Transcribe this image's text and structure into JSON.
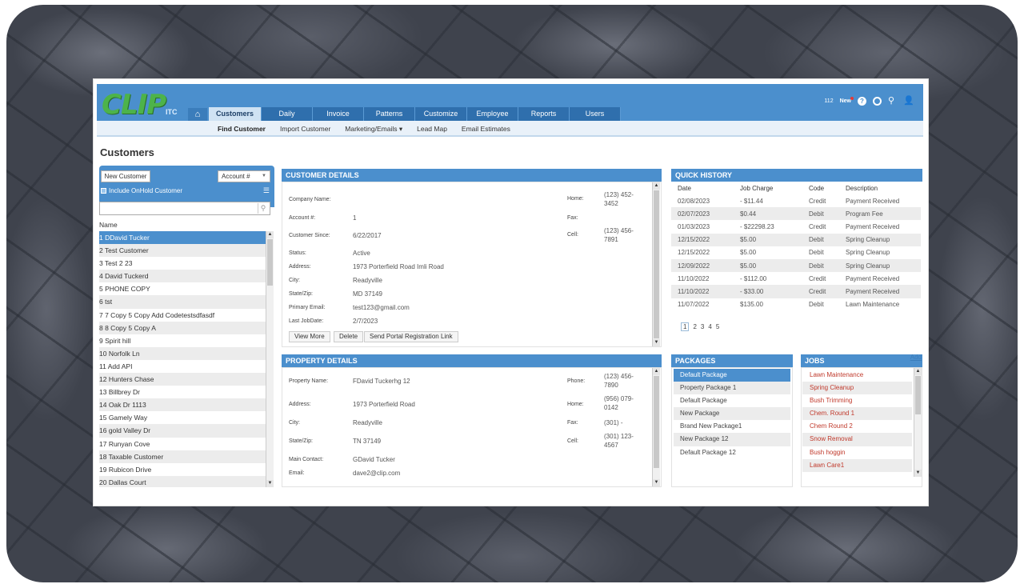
{
  "header": {
    "logo_text": "CLIP",
    "logo_sub": "ITC",
    "count": "112",
    "news_label": "New",
    "nav": [
      "Customers",
      "Daily",
      "Invoice",
      "Patterns",
      "Customize",
      "Employee",
      "Reports",
      "Users"
    ]
  },
  "subnav": [
    "Find Customer",
    "Import Customer",
    "Marketing/Emails ▾",
    "Lead Map",
    "Email Estimates"
  ],
  "page_title": "Customers",
  "left": {
    "new_customer": "New Customer",
    "account_select": "Account #",
    "onhold_label": "Include OnHold Customer",
    "search_value": "",
    "column_header": "Name",
    "customers": [
      "1 DDavid Tucker",
      "2 Test Customer",
      "3 Test 2 23",
      "4 David Tuckerd",
      "5 PHONE COPY",
      "6 tst",
      "7 7 Copy 5 Copy Add Codetestsdfasdf",
      "8 8 Copy 5 Copy A",
      "9 Spirit hill",
      "10 Norfolk Ln",
      "11 Add API",
      "12 Hunters Chase",
      "13 Billbrey Dr",
      "14 Oak Dr 1113",
      "15 Gamely Way",
      "16 gold Valley Dr",
      "17 Runyan Cove",
      "18 Taxable Customer",
      "19 Rubicon Drive",
      "20 Dallas Court"
    ]
  },
  "customer_details": {
    "title": "CUSTOMER DETAILS",
    "company_label": "Company Name:",
    "company": "",
    "account_label": "Account #:",
    "account": "1",
    "since_label": "Customer Since:",
    "since": "6/22/2017",
    "status_label": "Status:",
    "status": "Active",
    "address_label": "Address:",
    "address": "1973 Porterfield Road Imli Road",
    "city_label": "City:",
    "city": "Readyville",
    "statezip_label": "State/Zip:",
    "statezip": "MD 37149",
    "email_label": "Primary Email:",
    "email": "test123@gmail.com",
    "lastjob_label": "Last JobDate:",
    "lastjob": "2/7/2023",
    "home_label": "Home:",
    "home": "(123) 452-3452",
    "fax_label": "Fax:",
    "fax": "",
    "cell_label": "Cell:",
    "cell": "(123) 456-7891",
    "btn_view": "View More",
    "btn_delete": "Delete",
    "btn_portal": "Send Portal Registration Link"
  },
  "property_details": {
    "title": "PROPERTY DETAILS",
    "name_label": "Property Name:",
    "name": "FDavid Tuckerhg 12",
    "address_label": "Address:",
    "address": "1973 Porterfield Road",
    "city_label": "City:",
    "city": "Readyville",
    "statezip_label": "State/Zip:",
    "statezip": "TN 37149",
    "contact_label": "Main Contact:",
    "contact": "GDavid Tucker",
    "email_label": "Email:",
    "email": "dave2@clip.com",
    "phone_label": "Phone:",
    "phone": "(123) 456-7890",
    "home_label": "Home:",
    "home": "(956) 079-0142",
    "fax_label": "Fax:",
    "fax": "(301) -",
    "cell_label": "Cell:",
    "cell": "(301) 123-4567"
  },
  "quick_history": {
    "title": "QUICK HISTORY",
    "headers": [
      "Date",
      "Job Charge",
      "Code",
      "Description"
    ],
    "rows": [
      [
        "02/08/2023",
        "- $11.44",
        "Credit",
        "Payment Received"
      ],
      [
        "02/07/2023",
        "$0.44",
        "Debit",
        "Program Fee"
      ],
      [
        "01/03/2023",
        "- $22298.23",
        "Credit",
        "Payment Received"
      ],
      [
        "12/15/2022",
        "$5.00",
        "Debit",
        "Spring Cleanup"
      ],
      [
        "12/15/2022",
        "$5.00",
        "Debit",
        "Spring Cleanup"
      ],
      [
        "12/09/2022",
        "$5.00",
        "Debit",
        "Spring Cleanup"
      ],
      [
        "11/10/2022",
        "- $112.00",
        "Credit",
        "Payment Received"
      ],
      [
        "11/10/2022",
        "- $33.00",
        "Credit",
        "Payment Received"
      ],
      [
        "11/07/2022",
        "$135.00",
        "Debit",
        "Lawn Maintenance"
      ]
    ],
    "pages": [
      "1",
      "2",
      "3",
      "4",
      "5"
    ]
  },
  "packages": {
    "title": "PACKAGES",
    "items": [
      "Default Package",
      "Property Package 1",
      "Default Package",
      "New Package",
      "Brand New Package1",
      "New Package 12",
      "Default Package 12"
    ]
  },
  "jobs": {
    "title": "JOBS",
    "add": "Add",
    "items": [
      "Lawn Maintenance",
      "Spring Cleanup",
      "Bush Trimming",
      "Chem. Round 1",
      "Chem Round 2",
      "Snow Removal",
      "Bush hoggin",
      "Lawn Care1"
    ]
  }
}
